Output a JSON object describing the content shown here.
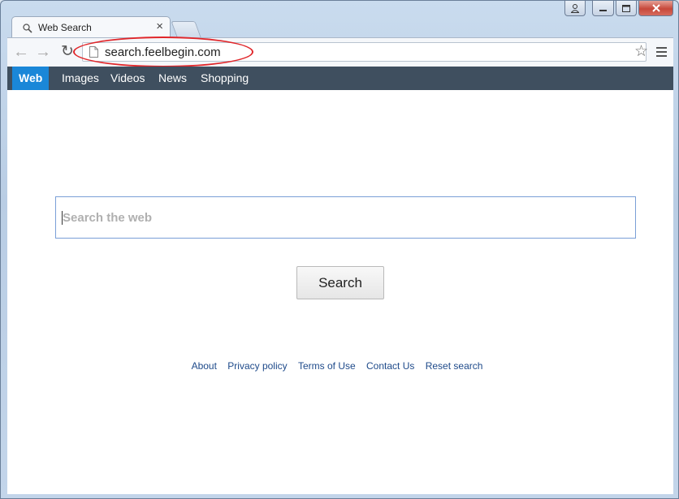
{
  "browser": {
    "tab_title": "Web Search",
    "tab_close": "×",
    "url": "search.feelbegin.com",
    "back_icon": "←",
    "forward_icon": "→",
    "reload_icon": "↻",
    "star_icon": "☆"
  },
  "nav": {
    "items": [
      {
        "label": "Web",
        "active": true
      },
      {
        "label": "Images"
      },
      {
        "label": "Videos"
      },
      {
        "label": "News"
      },
      {
        "label": "Shopping"
      }
    ]
  },
  "search": {
    "placeholder": "Search the web",
    "value": "",
    "button_label": "Search"
  },
  "footer": {
    "links": [
      "About",
      "Privacy policy",
      "Terms of Use",
      "Contact Us",
      "Reset search"
    ]
  },
  "colors": {
    "active_nav": "#1a87d8",
    "nav_bar": "#3f4f5f",
    "highlight": "#e0262a",
    "link": "#1e4a8a"
  }
}
